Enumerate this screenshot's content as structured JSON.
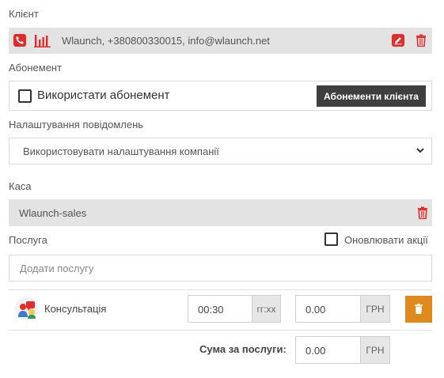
{
  "client": {
    "label": "Клієнт",
    "value": "Wlaunch, +380800330015, info@wlaunch.net"
  },
  "subscription": {
    "label": "Абонемент",
    "checkbox_label": "Використати абонемент",
    "button_label": "Абонементи клієнта"
  },
  "notifications": {
    "label": "Налаштування повідомлень",
    "selected": "Використовувати налаштування компанії"
  },
  "cashbox": {
    "label": "Каса",
    "value": "Wlaunch-sales"
  },
  "service": {
    "label": "Послуга",
    "update_promos_label": "Оновлювати акції",
    "placeholder": "Додати послугу",
    "items": [
      {
        "name": "Консультація",
        "duration": "00:30",
        "duration_unit": "гг:хх",
        "price": "0.00",
        "currency": "ГРН"
      }
    ]
  },
  "total": {
    "label": "Сума за послуги:",
    "value": "0.00",
    "currency": "ГРН"
  },
  "colors": {
    "accent_red": "#e52a2a",
    "delete_orange": "#e08a1e",
    "dark_button": "#3f3f3f"
  },
  "icons": {
    "client_actions": [
      "phone-icon",
      "chart-bars-icon"
    ],
    "client_edit": "pencil-icon",
    "trash": "trash-icon"
  }
}
